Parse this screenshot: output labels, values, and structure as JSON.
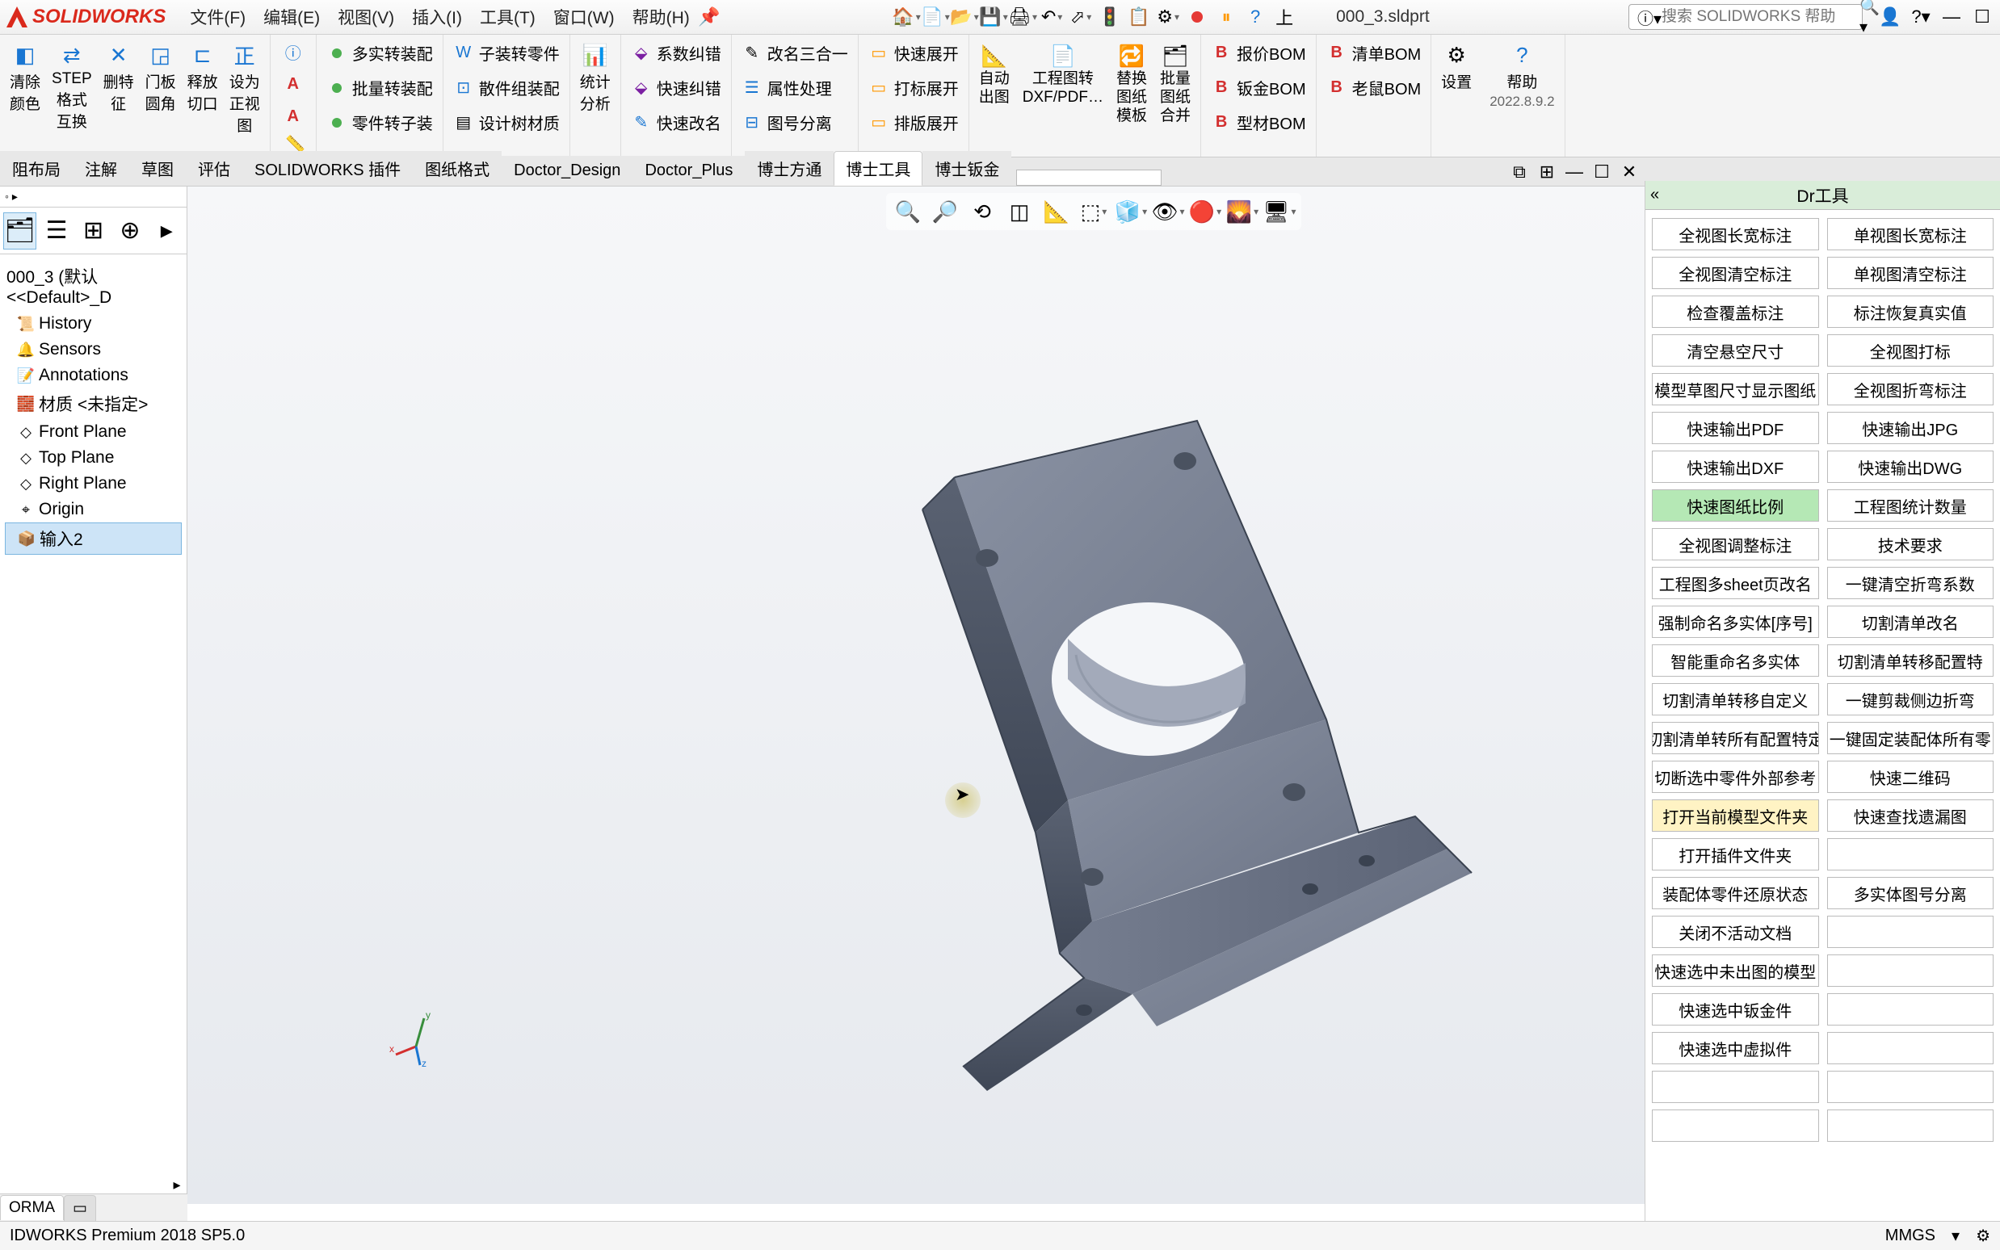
{
  "title": {
    "logo": "SOLIDWORKS",
    "menus": [
      "文件(F)",
      "编辑(E)",
      "视图(V)",
      "插入(I)",
      "工具(T)",
      "窗口(W)",
      "帮助(H)"
    ],
    "filename": "000_3.sldprt",
    "search_ph": "搜索 SOLIDWORKS 帮助",
    "upload": "上"
  },
  "ribbon": {
    "g1": [
      {
        "label": "清除\n颜色"
      },
      {
        "label": "STEP\n格式\n互换"
      },
      {
        "label": "删特\n征"
      },
      {
        "label": "门板\n圆角"
      },
      {
        "label": "释放\n切口"
      },
      {
        "label": "设为\n正视\n图"
      }
    ],
    "g2_rows": [
      {
        "icon": "green-dot",
        "label": "多实转装配"
      },
      {
        "icon": "green-dot",
        "label": "批量转装配"
      },
      {
        "icon": "green-dot",
        "label": "零件转子装"
      }
    ],
    "g3_rows": [
      {
        "label": "子装转零件"
      },
      {
        "label": "散件组装配"
      },
      {
        "label": "设计树材质"
      }
    ],
    "g4": {
      "label": "统计\n分析"
    },
    "g5_rows": [
      {
        "label": "系数纠错"
      },
      {
        "label": "快速纠错"
      },
      {
        "label": "快速改名"
      }
    ],
    "g6_rows": [
      {
        "label": "改名三合一"
      },
      {
        "label": "属性处理"
      },
      {
        "label": "图号分离"
      }
    ],
    "g7_rows": [
      {
        "label": "快速展开"
      },
      {
        "label": "打标展开"
      },
      {
        "label": "排版展开"
      }
    ],
    "g8": [
      {
        "label": "自动\n出图"
      },
      {
        "label": "工程图转\nDXF/PDF…"
      },
      {
        "label": "替换\n图纸\n模板"
      },
      {
        "label": "批量\n图纸\n合并"
      }
    ],
    "g9_rows": [
      {
        "label": "报价BOM"
      },
      {
        "label": "钣金BOM"
      },
      {
        "label": "型材BOM"
      }
    ],
    "g9b_rows": [
      {
        "label": "清单BOM"
      },
      {
        "label": "老鼠BOM"
      }
    ],
    "g10": [
      {
        "label": "设置"
      },
      {
        "label": "帮助",
        "sub": "2022.8.9.2"
      }
    ]
  },
  "tabs": [
    "阻布局",
    "注解",
    "草图",
    "评估",
    "SOLIDWORKS 插件",
    "图纸格式",
    "Doctor_Design",
    "Doctor_Plus",
    "博士方通",
    "博士工具",
    "博士钣金"
  ],
  "active_tab": 9,
  "tree": {
    "root": "000_3 (默认<<Default>_D",
    "items": [
      {
        "icon": "📜",
        "label": "History"
      },
      {
        "icon": "🔔",
        "label": "Sensors"
      },
      {
        "icon": "📝",
        "label": "Annotations"
      },
      {
        "icon": "🧱",
        "label": "材质 <未指定>"
      },
      {
        "icon": "◇",
        "label": "Front Plane"
      },
      {
        "icon": "◇",
        "label": "Top Plane"
      },
      {
        "icon": "◇",
        "label": "Right Plane"
      },
      {
        "icon": "⌖",
        "label": "Origin"
      },
      {
        "icon": "📦",
        "label": "输入2",
        "sel": true
      }
    ]
  },
  "dr": {
    "title": "Dr工具",
    "buttons": [
      [
        "全视图长宽标注",
        "单视图长宽标注"
      ],
      [
        "全视图清空标注",
        "单视图清空标注"
      ],
      [
        "检查覆盖标注",
        "标注恢复真实值"
      ],
      [
        "清空悬空尺寸",
        "全视图打标"
      ],
      [
        "模型草图尺寸显示图纸",
        "全视图折弯标注"
      ],
      [
        "快速输出PDF",
        "快速输出JPG"
      ],
      [
        "快速输出DXF",
        "快速输出DWG"
      ],
      [
        "快速图纸比例",
        "工程图统计数量"
      ],
      [
        "全视图调整标注",
        "技术要求"
      ],
      [
        "工程图多sheet页改名",
        "一键清空折弯系数"
      ],
      [
        "强制命名多实体[序号]",
        "切割清单改名"
      ],
      [
        "智能重命名多实体",
        "切割清单转移配置特"
      ],
      [
        "切割清单转移自定义",
        "一键剪裁侧边折弯"
      ],
      [
        "切割清单转所有配置特定",
        "一键固定装配体所有零"
      ],
      [
        "切断选中零件外部参考",
        "快速二维码"
      ],
      [
        "打开当前模型文件夹",
        "快速查找遗漏图"
      ],
      [
        "打开插件文件夹",
        ""
      ],
      [
        "装配体零件还原状态",
        "多实体图号分离"
      ],
      [
        "关闭不活动文档",
        ""
      ],
      [
        "快速选中未出图的模型",
        ""
      ],
      [
        "快速选中钣金件",
        ""
      ],
      [
        "快速选中虚拟件",
        ""
      ],
      [
        "",
        ""
      ],
      [
        "",
        ""
      ]
    ],
    "green_idx": 7,
    "yellow_idx": 15
  },
  "bottom_tab": "ORMA",
  "status": {
    "left": "IDWORKS Premium 2018 SP5.0",
    "units": "MMGS"
  },
  "triad": {
    "x": "x",
    "y": "y",
    "z": "z"
  }
}
